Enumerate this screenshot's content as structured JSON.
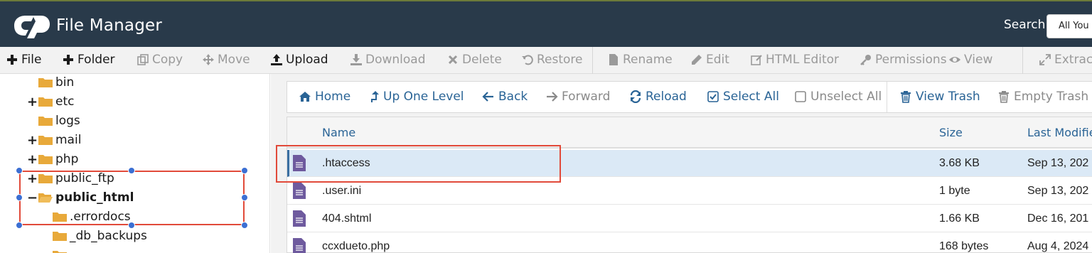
{
  "header": {
    "app_title": "File Manager",
    "search_label": "Search",
    "search_value": "All You"
  },
  "toolbar": {
    "file": "File",
    "folder": "Folder",
    "copy": "Copy",
    "move": "Move",
    "upload": "Upload",
    "download": "Download",
    "delete": "Delete",
    "restore": "Restore",
    "rename": "Rename",
    "edit": "Edit",
    "html_editor": "HTML Editor",
    "permissions": "Permissions",
    "view": "View",
    "extract": "Extract"
  },
  "tree": {
    "items": [
      {
        "label": "bin",
        "toggle": ""
      },
      {
        "label": "etc",
        "toggle": "+"
      },
      {
        "label": "logs",
        "toggle": ""
      },
      {
        "label": "mail",
        "toggle": "+"
      },
      {
        "label": "php",
        "toggle": "+"
      },
      {
        "label": "public_ftp",
        "toggle": "+"
      },
      {
        "label": "public_html",
        "toggle": "−"
      },
      {
        "label": ".errordocs",
        "toggle": ""
      },
      {
        "label": "_db_backups",
        "toggle": ""
      }
    ]
  },
  "nav": {
    "home": "Home",
    "up_one_level": "Up One Level",
    "back": "Back",
    "forward": "Forward",
    "reload": "Reload",
    "select_all": "Select All",
    "unselect_all": "Unselect All",
    "view_trash": "View Trash",
    "empty_trash": "Empty Trash"
  },
  "table": {
    "columns": {
      "name": "Name",
      "size": "Size",
      "modified": "Last Modifie"
    },
    "rows": [
      {
        "name": ".htaccess",
        "size": "3.68 KB",
        "modified": "Sep 13, 202"
      },
      {
        "name": ".user.ini",
        "size": "1 byte",
        "modified": "Sep 13, 202"
      },
      {
        "name": "404.shtml",
        "size": "1.66 KB",
        "modified": "Dec 16, 201"
      },
      {
        "name": "ccxdueto.php",
        "size": "168 bytes",
        "modified": "Aug 4, 2024"
      }
    ]
  },
  "colors": {
    "header_bg": "#293a4a",
    "link_blue": "#2a6496",
    "selected_row": "#dbe9f6",
    "folder": "#e8a93a",
    "file_icon": "#6e5a9e",
    "annotation_red": "#e14a3a",
    "handle_blue": "#3b6fd3"
  },
  "icons": {
    "logo": "cpanel-logo",
    "file": "plus-icon",
    "folder": "plus-icon",
    "copy": "copy-icon",
    "move": "move-icon",
    "upload": "upload-icon",
    "download": "download-icon",
    "delete": "times-icon",
    "restore": "undo-icon",
    "rename": "file-icon",
    "edit": "pencil-icon",
    "html_editor": "edit-square-icon",
    "permissions": "key-icon",
    "view": "eye-icon",
    "extract": "expand-icon"
  }
}
